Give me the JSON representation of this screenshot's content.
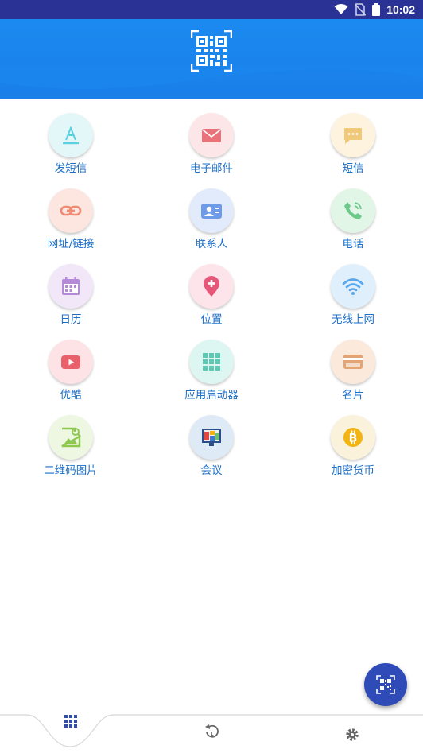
{
  "status_bar": {
    "time": "10:02"
  },
  "header": {
    "icon": "qr-code-icon"
  },
  "items": [
    {
      "label": "发短信",
      "icon": "letter-a-icon",
      "color": "#5ad1e0",
      "bg": "#e3f7f9"
    },
    {
      "label": "电子邮件",
      "icon": "email-icon",
      "color": "#e8737a",
      "bg": "#fde6e8"
    },
    {
      "label": "短信",
      "icon": "message-icon",
      "color": "#f0c97a",
      "bg": "#fdf3df"
    },
    {
      "label": "网址/链接",
      "icon": "link-icon",
      "color": "#f08a72",
      "bg": "#fde5e0"
    },
    {
      "label": "联系人",
      "icon": "contact-card-icon",
      "color": "#6e9be8",
      "bg": "#e2ebfb"
    },
    {
      "label": "电话",
      "icon": "phone-icon",
      "color": "#6cc98a",
      "bg": "#e2f6e8"
    },
    {
      "label": "日历",
      "icon": "calendar-icon",
      "color": "#b48ad8",
      "bg": "#f1e7f9"
    },
    {
      "label": "位置",
      "icon": "location-pin-icon",
      "color": "#e8577a",
      "bg": "#fde3ea"
    },
    {
      "label": "无线上网",
      "icon": "wifi-icon",
      "color": "#5aa8ec",
      "bg": "#e0effc"
    },
    {
      "label": "优酷",
      "icon": "video-icon",
      "color": "#e8606a",
      "bg": "#fde3e6"
    },
    {
      "label": "应用启动器",
      "icon": "app-grid-icon",
      "color": "#5cc9b4",
      "bg": "#def6f1"
    },
    {
      "label": "名片",
      "icon": "card-icon",
      "color": "#e3a576",
      "bg": "#fbe9dc"
    },
    {
      "label": "二维码图片",
      "icon": "qr-image-icon",
      "color": "#8cc94e",
      "bg": "#eef7e2"
    },
    {
      "label": "会议",
      "icon": "meeting-icon",
      "color": "#3a7bd5",
      "bg": "#dfeaf7"
    },
    {
      "label": "加密货币",
      "icon": "bitcoin-icon",
      "color": "#f2b413",
      "bg": "#fbf2dc"
    }
  ],
  "fab": {
    "icon": "qr-scan-icon",
    "color": "#2f4bb8"
  },
  "bottom_nav": [
    {
      "name": "apps",
      "icon": "grid-icon"
    },
    {
      "name": "history",
      "icon": "history-icon"
    },
    {
      "name": "settings",
      "icon": "gear-icon"
    }
  ]
}
